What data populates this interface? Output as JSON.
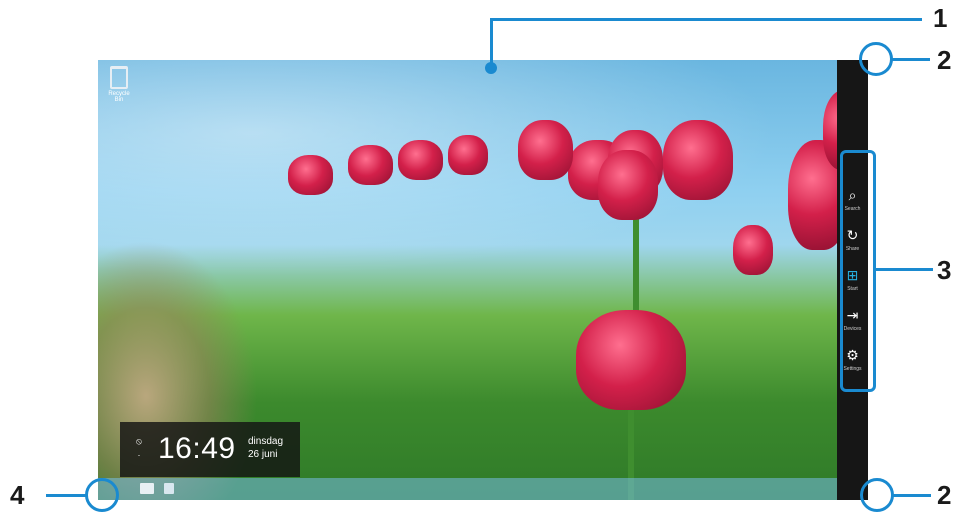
{
  "desktop": {
    "recycle_bin_label": "Recycle Bin"
  },
  "clock": {
    "network_top": "⦸",
    "network_bottom": "·",
    "time": "16:49",
    "day_line1": "dinsdag",
    "day_line2": "26 juni"
  },
  "taskbar": {
    "tray_text": "▴ ✉"
  },
  "charms": [
    {
      "icon": "search-icon",
      "glyph": "⌕",
      "label": "Search"
    },
    {
      "icon": "share-icon",
      "glyph": "↻",
      "label": "Share"
    },
    {
      "icon": "start-icon",
      "glyph": "⊞",
      "label": "Start"
    },
    {
      "icon": "devices-icon",
      "glyph": "⇥",
      "label": "Devices"
    },
    {
      "icon": "settings-icon",
      "glyph": "⚙",
      "label": "Settings"
    }
  ],
  "callouts": {
    "c1": "1",
    "c2_top": "2",
    "c3": "3",
    "c4": "4",
    "c2_bottom": "2"
  },
  "colors": {
    "callout": "#1a8ad0",
    "charm_bg": "#161616"
  }
}
